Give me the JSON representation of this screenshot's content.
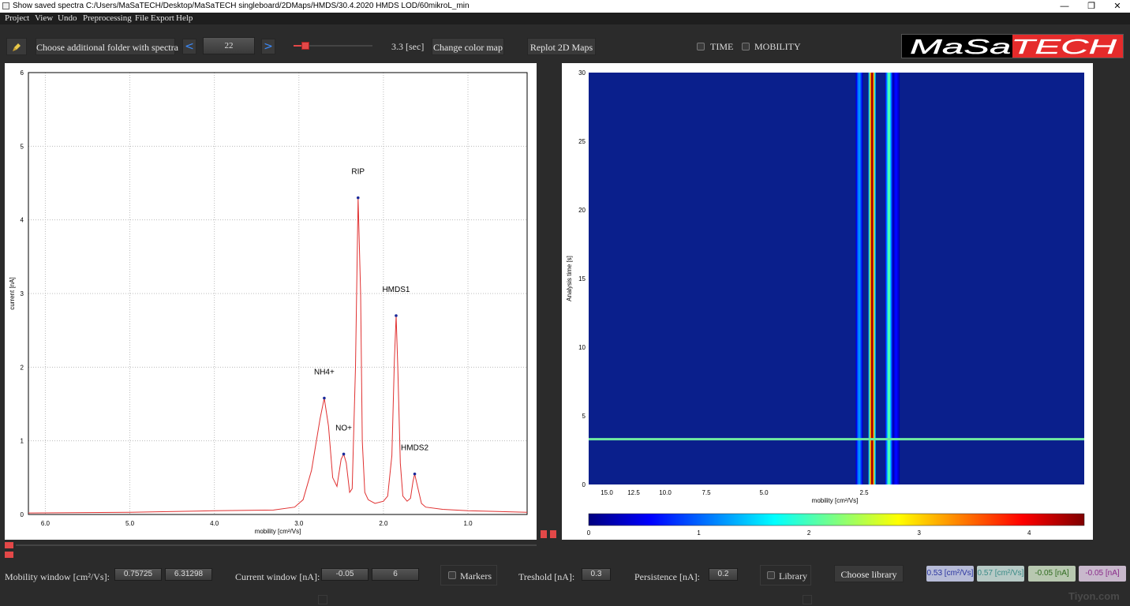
{
  "window": {
    "title": "Show saved spectra C:/Users/MaSaTECH/Desktop/MaSaTECH singleboard/2DMaps/HMDS/30.4.2020 HMDS LOD/60mikroL_min",
    "minimize": "—",
    "restore": "❐",
    "close": "✕"
  },
  "menu": [
    "Project",
    "View",
    "Undo",
    "Preprocessing",
    "File Export",
    "Help"
  ],
  "toolbar": {
    "choose_folder": "Choose additional folder with spectra",
    "prev": "<",
    "spectrum_index": "22",
    "next": ">",
    "time_value": "3.3 [sec]",
    "change_colormap": "Change color map",
    "replot": "Replot 2D Maps",
    "time_check": "TIME",
    "mobility_check": "MOBILITY",
    "logo_text": "MaSaTECH"
  },
  "spectrum_chart": {
    "xlabel": "mobility [cm²/Vs]",
    "ylabel": "current [nA]",
    "x_ticks": [
      "6.0",
      "5.0",
      "4.0",
      "3.0",
      "2.0",
      "1.0"
    ],
    "y_ticks": [
      "0",
      "1",
      "2",
      "3",
      "4",
      "5",
      "6"
    ],
    "peak_labels": [
      "RIP",
      "HMDS1",
      "NH4+",
      "NO+",
      "HMDS2"
    ]
  },
  "heatmap_chart": {
    "xlabel": "mobility [cm²/Vs]",
    "ylabel": "Analysis time [s]",
    "x_ticks": [
      "15.0",
      "12.5",
      "10.0",
      "7.5",
      "5.0",
      "2.5"
    ],
    "y_ticks": [
      "0",
      "5",
      "10",
      "15",
      "20",
      "25",
      "30"
    ],
    "colorbar_ticks": [
      "0",
      "1",
      "2",
      "3",
      "4"
    ]
  },
  "chart_data": [
    {
      "type": "line",
      "xlabel": "mobility [cm²/Vs]",
      "ylabel": "current [nA]",
      "xlim": [
        6.2,
        0.3
      ],
      "ylim": [
        0,
        6
      ],
      "series": [
        {
          "color": "#e03030",
          "x": [
            6.2,
            5.0,
            4.0,
            3.3,
            3.05,
            2.95,
            2.85,
            2.75,
            2.7,
            2.65,
            2.6,
            2.55,
            2.5,
            2.47,
            2.44,
            2.4,
            2.37,
            2.33,
            2.3,
            2.27,
            2.25,
            2.22,
            2.18,
            2.1,
            2.0,
            1.95,
            1.9,
            1.87,
            1.85,
            1.83,
            1.8,
            1.77,
            1.72,
            1.68,
            1.65,
            1.63,
            1.6,
            1.55,
            1.5,
            1.3,
            1.0,
            0.3
          ],
          "y": [
            0.02,
            0.03,
            0.05,
            0.06,
            0.1,
            0.2,
            0.6,
            1.3,
            1.58,
            1.2,
            0.5,
            0.38,
            0.75,
            0.82,
            0.7,
            0.3,
            0.35,
            2.0,
            4.3,
            3.0,
            1.0,
            0.3,
            0.2,
            0.15,
            0.18,
            0.25,
            0.8,
            2.1,
            2.7,
            2.0,
            0.7,
            0.25,
            0.18,
            0.22,
            0.45,
            0.55,
            0.4,
            0.15,
            0.1,
            0.07,
            0.05,
            0.03
          ]
        }
      ],
      "peaks": [
        {
          "label": "NH4+",
          "x": 2.7,
          "y": 1.58
        },
        {
          "label": "NO+",
          "x": 2.47,
          "y": 0.82
        },
        {
          "label": "RIP",
          "x": 2.3,
          "y": 4.3
        },
        {
          "label": "HMDS1",
          "x": 1.85,
          "y": 2.7
        },
        {
          "label": "HMDS2",
          "x": 1.63,
          "y": 0.55
        }
      ]
    },
    {
      "type": "heatmap",
      "xlabel": "mobility [cm²/Vs]",
      "ylabel": "Analysis time [s]",
      "ylim": [
        0,
        30
      ],
      "colorbar_range": [
        0,
        4.5
      ],
      "bands": [
        {
          "x": 2.62,
          "intensity": 1.2
        },
        {
          "x": 2.3,
          "intensity": 4.3
        },
        {
          "x": 1.88,
          "intensity": 2.0
        },
        {
          "x": 1.7,
          "intensity": 0.6
        }
      ],
      "cursor_time": 3.3
    }
  ],
  "bottom": {
    "mobility_window_label": "Mobility window [cm²/Vs]:",
    "mobility_min": "0.75725",
    "mobility_max": "6.31298",
    "current_window_label": "Current window [nA]:",
    "current_min": "-0.05",
    "current_max": "6",
    "markers": "Markers",
    "threshold_label": "Treshold [nA]:",
    "threshold": "0.3",
    "persistence_label": "Persistence [nA]:",
    "persistence": "0.2",
    "library": "Library",
    "choose_library": "Choose library",
    "readout1": "0.53 [cm²/Vs]",
    "readout2": "0.57 [cm²/Vs]",
    "readout3": "-0.05 [nA]",
    "readout4": "-0.05 [nA]"
  },
  "watermark": "Tiyon.com"
}
